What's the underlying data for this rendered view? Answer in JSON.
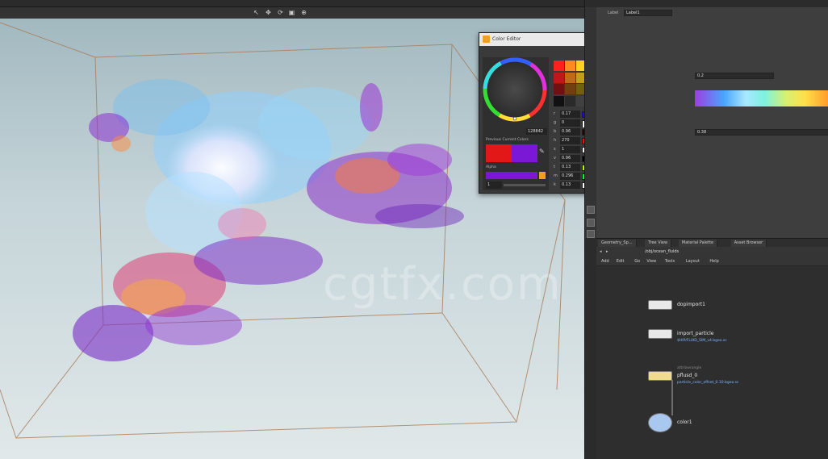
{
  "color_editor": {
    "title": "Color Editor",
    "hex_value": "128842",
    "previous_label": "Previous Current Colors",
    "alpha_label": "Alpha",
    "alpha_value": "1",
    "rows": [
      {
        "key": "r",
        "value": "0.17"
      },
      {
        "key": "g",
        "value": "0"
      },
      {
        "key": "b",
        "value": "0.96"
      },
      {
        "key": "h",
        "value": "270"
      },
      {
        "key": "s",
        "value": "1"
      },
      {
        "key": "v",
        "value": "0.96"
      },
      {
        "key": "t",
        "value": "0.13"
      },
      {
        "key": "m",
        "value": "0.296"
      },
      {
        "key": "k",
        "value": "0.13"
      }
    ],
    "previous_color": "#e21818",
    "current_color": "#7b18d6"
  },
  "right_panel": {
    "label": "Label",
    "label_value": "Label1",
    "ramp_value": "0.38",
    "field_value": "0.2"
  },
  "network": {
    "tabs": [
      "Geometry_Sp...",
      "Tree View",
      "Material Palette",
      "Asset Browser"
    ],
    "path": "/obj/ocean_fluids",
    "menu": [
      "Add",
      "Edit",
      "Go",
      "View",
      "Tools",
      "Layout",
      "Help"
    ],
    "nodes": [
      {
        "name": "dopimport1",
        "type": "",
        "sub": ""
      },
      {
        "name": "import_particle",
        "type": "",
        "sub": "$HIP/FLUID_SIM_v4.bgeo.sc"
      },
      {
        "name": "pflusd_0",
        "type": "attribwrangle",
        "sub": "particle_color_offset_0.10.bgeo.sc"
      },
      {
        "name": "color1",
        "type": "",
        "sub": ""
      }
    ]
  },
  "watermark": "cgtfx.com"
}
